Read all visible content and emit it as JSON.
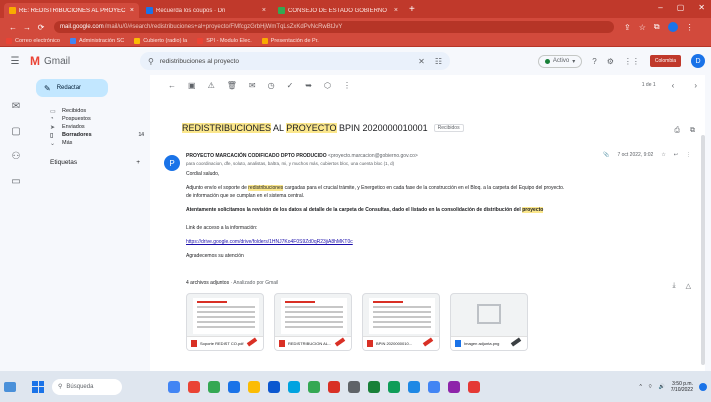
{
  "browser": {
    "tabs": [
      {
        "label": "RE: REDISTRIBUCIONES AL PROYECTO",
        "fav_color": "#f9ab00",
        "active": true
      },
      {
        "label": "Recuerda los coupos · Dn",
        "fav_color": "#1a73e8",
        "active": false
      },
      {
        "label": "CONSEJO DE ESTADO GOBIERNO",
        "fav_color": "#34a853",
        "active": false
      }
    ],
    "url_host": "mail.google.com",
    "url_rest": "/mail/u/0/#search/redistribuciones+al+proyecto/FMfcgzGrbHjWmTqLsZxKdPvNcRwBtJvY",
    "bookmarks": [
      {
        "label": "Correo electrónico",
        "fav_color": "#ea4335"
      },
      {
        "label": "Administración SC",
        "fav_color": "#4285f4"
      },
      {
        "label": "Cubierto (radio) la",
        "fav_color": "#fbbc04"
      },
      {
        "label": "SPI - Modulo Elec.",
        "fav_color": "#ea4335"
      },
      {
        "label": "Presentación de Pr.",
        "fav_color": "#f9ab00"
      }
    ]
  },
  "gmail": {
    "product_name": "Gmail",
    "search_query": "redistribuciones al proyecto",
    "status_label": "Activo",
    "org_badge": "Colombia",
    "avatar_letter": "D",
    "compose_label": "Redactar",
    "folders": [
      {
        "label": "Recibidos",
        "icon": "inbox-icon",
        "glyph": "▭",
        "count": "",
        "selected": false
      },
      {
        "label": "Pospuestos",
        "icon": "clock-icon",
        "glyph": "◔",
        "count": "",
        "selected": false
      },
      {
        "label": "Enviados",
        "icon": "send-icon",
        "glyph": "➤",
        "count": "",
        "selected": false
      },
      {
        "label": "Borradores",
        "icon": "draft-icon",
        "glyph": "▯",
        "count": "14",
        "selected": true
      },
      {
        "label": "Más",
        "icon": "chevron-down-icon",
        "glyph": "⌄",
        "count": "",
        "selected": false
      }
    ],
    "labels_header": "Etiquetas",
    "pager": "1 de 1"
  },
  "email": {
    "subject_parts": [
      {
        "text": "REDISTRIBUCIONES",
        "highlight": true
      },
      {
        "text": " AL ",
        "highlight": false
      },
      {
        "text": "PROYECTO",
        "highlight": true
      },
      {
        "text": " BPIN 2020000010001",
        "highlight": false
      }
    ],
    "inbox_tag": "Recibidos",
    "sender_name": "PROYECTO MARCACIÓN CODIFICADO DPTO PRODUCIDO",
    "sender_email": "<proyecto.marcacion@gobierno.gov.co>",
    "to_line": "para coordinacion, dfe, soluto, analistas, baltra, mi, y muchos más, cubiertos bloc, una cuenta bloc (1, d)",
    "date": "7 oct 2022, 9:02",
    "greeting": "Cordial saludo,",
    "paragraph1_pre": "Adjunto envío el soporte de ",
    "paragraph1_hl": "redistribuciones",
    "paragraph1_post": " cargadas para el crucial trámite, y Energetico en cada fase de la construcción en el Bloq. a la carpeta del Equipo del proyecto.",
    "paragraph1_line2": "de información que se cumplan en el sistema central.",
    "paragraph2_pre": "Atentamente solicitamos la revisión de los datos al detalle de la carpeta de Consultas, dado el listado en la consolidación de distribución del ",
    "paragraph2_hl": "proyecto",
    "paragraph3": "Link de acceso a la información:",
    "link": "https://drive.google.com/drive/folders/1HNJ7Ko4F0S9Zd0qR23jiA8hMKT0c",
    "sign_off": "Agradecemos su atención",
    "attachments_title": "4 archivos adjuntos",
    "attachments_sub": " · Analizado por Gmail",
    "attachments": [
      {
        "name": "Soporte REDIST CO.pdf",
        "kind": "pdf"
      },
      {
        "name": "REDISTRIBUCION AL...",
        "kind": "pdf"
      },
      {
        "name": "BPIN 2020000010...",
        "kind": "pdf"
      },
      {
        "name": "Imagen adjunta.png",
        "kind": "img"
      }
    ]
  },
  "taskbar": {
    "search_label": "Búsqueda",
    "time": "3:50 p.m.",
    "date": "7/10/2022",
    "app_colors": [
      "#4285f4",
      "#ea4335",
      "#34a853",
      "#1a73e8",
      "#fbbc04",
      "#0b57d0",
      "#00a3e0",
      "#34a853",
      "#d93025",
      "#5f6368",
      "#188038",
      "#0f9d58",
      "#1e88e5",
      "#4285f4",
      "#8e24aa",
      "#e53935"
    ]
  }
}
